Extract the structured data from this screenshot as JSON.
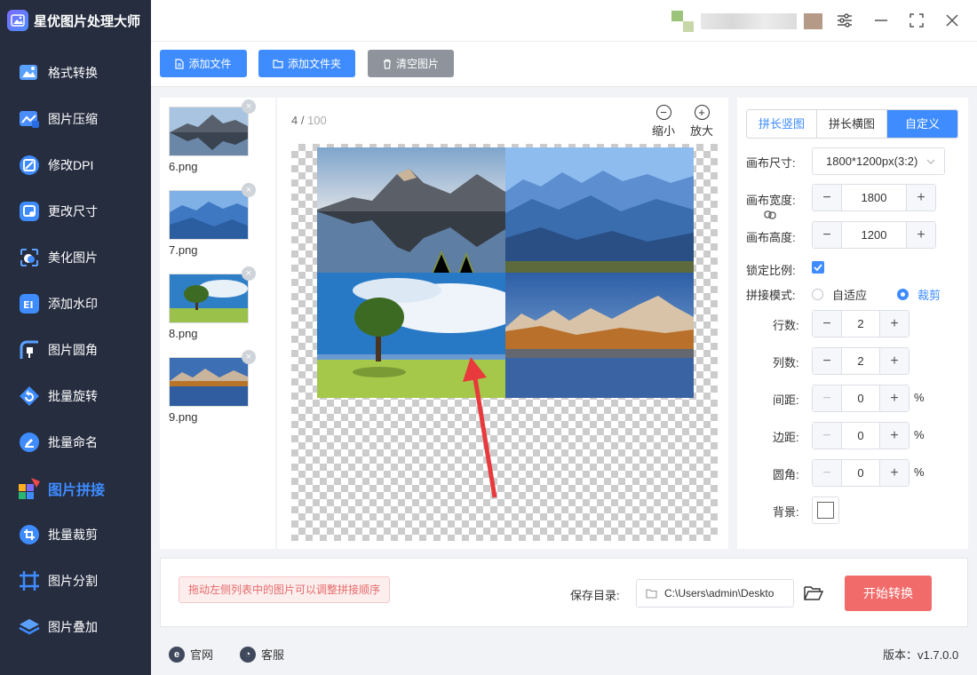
{
  "app": {
    "title": "星优图片处理大师"
  },
  "sidebar": {
    "items": [
      {
        "label": "格式转换",
        "icon": "image-convert-icon"
      },
      {
        "label": "图片压缩",
        "icon": "image-compress-icon"
      },
      {
        "label": "修改DPI",
        "icon": "dpi-icon"
      },
      {
        "label": "更改尺寸",
        "icon": "resize-icon"
      },
      {
        "label": "美化图片",
        "icon": "beautify-icon"
      },
      {
        "label": "添加水印",
        "icon": "watermark-icon"
      },
      {
        "label": "图片圆角",
        "icon": "rounded-corner-icon"
      },
      {
        "label": "批量旋转",
        "icon": "rotate-icon"
      },
      {
        "label": "批量命名",
        "icon": "rename-icon"
      },
      {
        "label": "图片拼接",
        "icon": "puzzle-icon",
        "active": true
      },
      {
        "label": "批量裁剪",
        "icon": "crop-icon"
      },
      {
        "label": "图片分割",
        "icon": "split-icon"
      },
      {
        "label": "图片叠加",
        "icon": "layers-icon"
      }
    ]
  },
  "toolbar": {
    "add_file": "添加文件",
    "add_folder": "添加文件夹",
    "clear": "清空图片"
  },
  "files": [
    {
      "name": "6.png"
    },
    {
      "name": "7.png"
    },
    {
      "name": "8.png"
    },
    {
      "name": "9.png"
    }
  ],
  "preview": {
    "count": "4",
    "separator": " / ",
    "total": "100",
    "zoom_out": "缩小",
    "zoom_in": "放大"
  },
  "settings": {
    "tabs": [
      "拼长竖图",
      "拼长横图",
      "自定义"
    ],
    "active_tab": "自定义",
    "canvas_size_label": "画布尺寸:",
    "canvas_size_value": "1800*1200px(3:2)",
    "width_label": "画布宽度:",
    "width_value": "1800",
    "height_label": "画布高度:",
    "height_value": "1200",
    "lock_ratio_label": "锁定比例:",
    "lock_ratio_checked": true,
    "mode_label": "拼接模式:",
    "mode_options": [
      "自适应",
      "裁剪"
    ],
    "mode_selected": "裁剪",
    "rows_label": "行数:",
    "rows_value": "2",
    "cols_label": "列数:",
    "cols_value": "2",
    "gap_label": "间距:",
    "gap_value": "0",
    "margin_label": "边距:",
    "margin_value": "0",
    "radius_label": "圆角:",
    "radius_value": "0",
    "bg_label": "背景:",
    "bg_color": "#ffffff",
    "percent": "%",
    "minus": "−",
    "plus": "+"
  },
  "bottom": {
    "hint": "拖动左侧列表中的图片可以调整拼接顺序",
    "save_label": "保存目录:",
    "save_path": "C:\\Users\\admin\\Deskto",
    "start": "开始转换"
  },
  "status": {
    "official": "官网",
    "support": "客服",
    "version": "版本：v1.7.0.0"
  },
  "colors": {
    "accent": "#3e8cff",
    "danger": "#f16b6b",
    "sidebar": "#262d3f"
  }
}
